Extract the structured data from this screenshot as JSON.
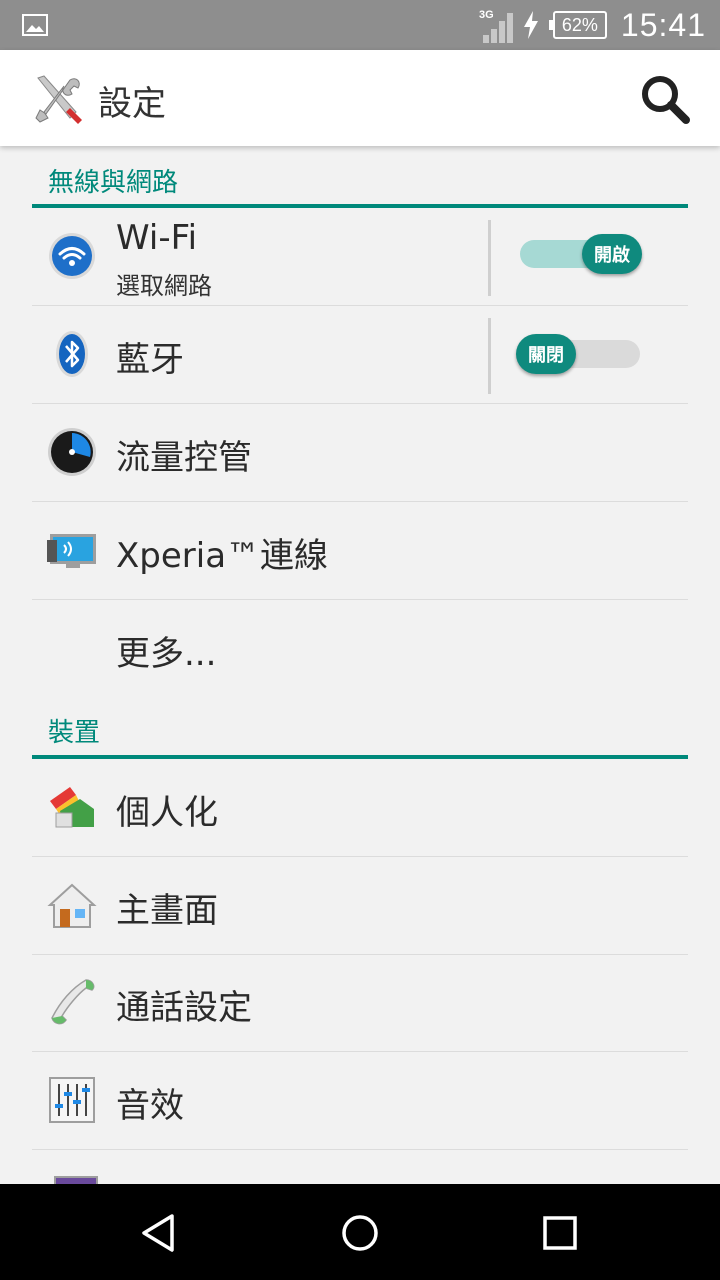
{
  "status_bar": {
    "network_type": "3G",
    "battery_percent": "62%",
    "charging": true,
    "time": "15:41",
    "left_icon": "image-notification-icon"
  },
  "action_bar": {
    "title": "設定",
    "app_icon": "settings-tools-icon",
    "search_icon": "search-icon"
  },
  "sections": {
    "wireless": {
      "header": "無線與網路",
      "items": {
        "wifi": {
          "title": "Wi-Fi",
          "subtitle": "選取網路",
          "icon": "wifi-icon",
          "toggle_label": "開啟",
          "toggle_on": true
        },
        "bluetooth": {
          "title": "藍牙",
          "icon": "bluetooth-icon",
          "toggle_label": "關閉",
          "toggle_on": false
        },
        "data_usage": {
          "title": "流量控管",
          "icon": "data-usage-icon"
        },
        "xperia_connect": {
          "title": "Xperia™連線",
          "icon": "xperia-connect-icon"
        },
        "more": {
          "title": "更多..."
        }
      }
    },
    "device": {
      "header": "裝置",
      "items": {
        "personalize": {
          "title": "個人化",
          "icon": "personalize-icon"
        },
        "home": {
          "title": "主畫面",
          "icon": "home-icon"
        },
        "call": {
          "title": "通話設定",
          "icon": "phone-icon"
        },
        "sound": {
          "title": "音效",
          "icon": "sound-equalizer-icon"
        }
      }
    }
  },
  "nav_bar": {
    "back": "back-icon",
    "home": "home-circle-icon",
    "recents": "recents-icon"
  },
  "colors": {
    "accent": "#00897b",
    "status_bar": "#8e8e8e",
    "background": "#f2f2f2"
  }
}
